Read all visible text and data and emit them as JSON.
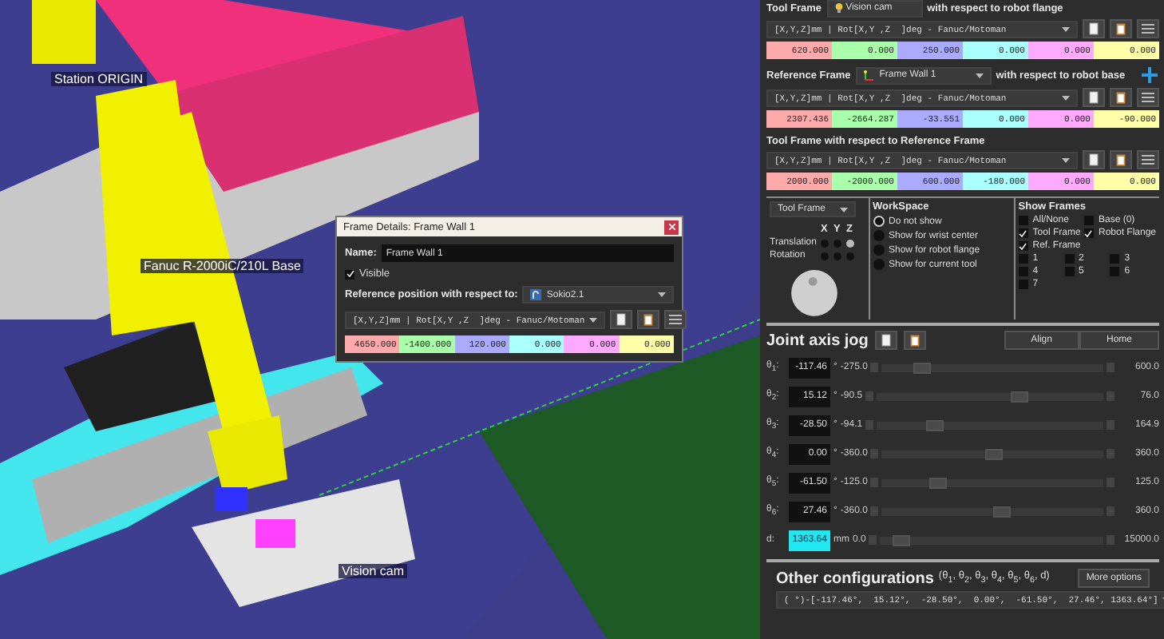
{
  "viewport": {
    "labels": [
      {
        "text": "Station ORIGIN"
      },
      {
        "text": "Fanuc R-2000iC/210L Base"
      },
      {
        "text": "Vision cam"
      }
    ]
  },
  "dialog": {
    "title": "Frame Details: Frame Wall 1",
    "name_label": "Name:",
    "name_value": "Frame Wall 1",
    "visible": {
      "label": "Visible",
      "checked": true
    },
    "reference_label": "Reference position with respect to:",
    "reference_value": "Sokio2.1",
    "format": "[X,Y,Z]mm | Rot[X,Y ,Z  ]deg - Fanuc/Motoman",
    "values": [
      "4650.000",
      "-1400.000",
      "120.000",
      "0.000",
      "0.000",
      "0.000"
    ]
  },
  "panel": {
    "tool_frame": {
      "label": "Tool Frame",
      "value": "Vision cam",
      "suffix": "with respect to robot flange",
      "format": "[X,Y,Z]mm | Rot[X,Y ,Z  ]deg - Fanuc/Motoman",
      "values": [
        "620.000",
        "0.000",
        "250.000",
        "0.000",
        "0.000",
        "0.000"
      ]
    },
    "reference_frame": {
      "label": "Reference Frame",
      "value": "Frame Wall 1",
      "suffix": "with respect to robot base",
      "format": "[X,Y,Z]mm | Rot[X,Y ,Z  ]deg - Fanuc/Motoman",
      "values": [
        "2307.436",
        "-2664.287",
        "-33.551",
        "0.000",
        "0.000",
        "-90.000"
      ]
    },
    "tool_wrt_ref": {
      "title": "Tool Frame with respect to Reference Frame",
      "format": "[X,Y,Z]mm | Rot[X,Y ,Z  ]deg - Fanuc/Motoman",
      "values": [
        "2000.000",
        "-2000.000",
        "600.000",
        "-180.000",
        "0.000",
        "0.000"
      ]
    },
    "frame_jog": {
      "dropdown": "Tool Frame",
      "axes": [
        "X",
        "Y",
        "Z"
      ],
      "rows": [
        {
          "label": "Translation",
          "dots": [
            {
              "selected": false
            },
            {
              "selected": false
            },
            {
              "selected": true
            }
          ]
        },
        {
          "label": "Rotation",
          "dots": [
            {
              "selected": false
            },
            {
              "selected": false
            },
            {
              "selected": false
            }
          ]
        }
      ]
    },
    "workspace": {
      "title": "WorkSpace",
      "options": [
        {
          "label": "Do not show",
          "selected": true
        },
        {
          "label": "Show for wrist center",
          "selected": false
        },
        {
          "label": "Show for robot flange",
          "selected": false
        },
        {
          "label": "Show for current tool",
          "selected": false
        }
      ]
    },
    "show_frames": {
      "title": "Show Frames",
      "named": [
        {
          "label": "All/None",
          "checked": false
        },
        {
          "label": "Base (0)",
          "checked": false
        },
        {
          "label": "Tool Frame",
          "checked": true
        },
        {
          "label": "Robot Flange",
          "checked": true
        },
        {
          "label": "Ref. Frame",
          "checked": true
        }
      ],
      "numbered": [
        {
          "label": "1",
          "checked": false
        },
        {
          "label": "2",
          "checked": false
        },
        {
          "label": "3",
          "checked": false
        },
        {
          "label": "4",
          "checked": false
        },
        {
          "label": "5",
          "checked": false
        },
        {
          "label": "6",
          "checked": false
        },
        {
          "label": "7",
          "checked": false
        }
      ]
    },
    "joint_jog": {
      "title": "Joint axis jog",
      "buttons": [
        "Align",
        "Home"
      ],
      "joints": [
        {
          "label": "θ$_{1}$:",
          "value": "-117.46",
          "unit": "°",
          "min": "-275.0",
          "max": "600.0",
          "level": 0.18,
          "highlighted": false
        },
        {
          "label": "θ$_{2}$:",
          "value": "15.12",
          "unit": "°",
          "min": "-90.5",
          "max": "76.0",
          "level": 0.63,
          "highlighted": false
        },
        {
          "label": "θ$_{3}$:",
          "value": "-28.50",
          "unit": "°",
          "min": "-94.1",
          "max": "164.9",
          "level": 0.25,
          "highlighted": false
        },
        {
          "label": "θ$_{4}$:",
          "value": "0.00",
          "unit": "°",
          "min": "-360.0",
          "max": "360.0",
          "level": 0.5,
          "highlighted": false
        },
        {
          "label": "θ$_{5}$:",
          "value": "-61.50",
          "unit": "°",
          "min": "-125.0",
          "max": "125.0",
          "level": 0.25,
          "highlighted": false
        },
        {
          "label": "θ$_{6}$:",
          "value": "27.46",
          "unit": "°",
          "min": "-360.0",
          "max": "360.0",
          "level": 0.54,
          "highlighted": false
        },
        {
          "label": "d:",
          "value": "1363.64",
          "unit": "mm",
          "min": "0.0",
          "max": "15000.0",
          "level": 0.09,
          "highlighted": true
        }
      ]
    },
    "other_configurations": {
      "title": "Other configurations",
      "subtitle": "(θ$_{1}$, θ$_{2}$, θ$_{3}$, θ$_{4}$, θ$_{5}$, θ$_{6}$, d)",
      "button": "More options",
      "value": "( °)-[-117.46°,  15.12°,  -28.50°,  0.00°,  -61.50°,  27.46°, 1363.64°]"
    }
  }
}
